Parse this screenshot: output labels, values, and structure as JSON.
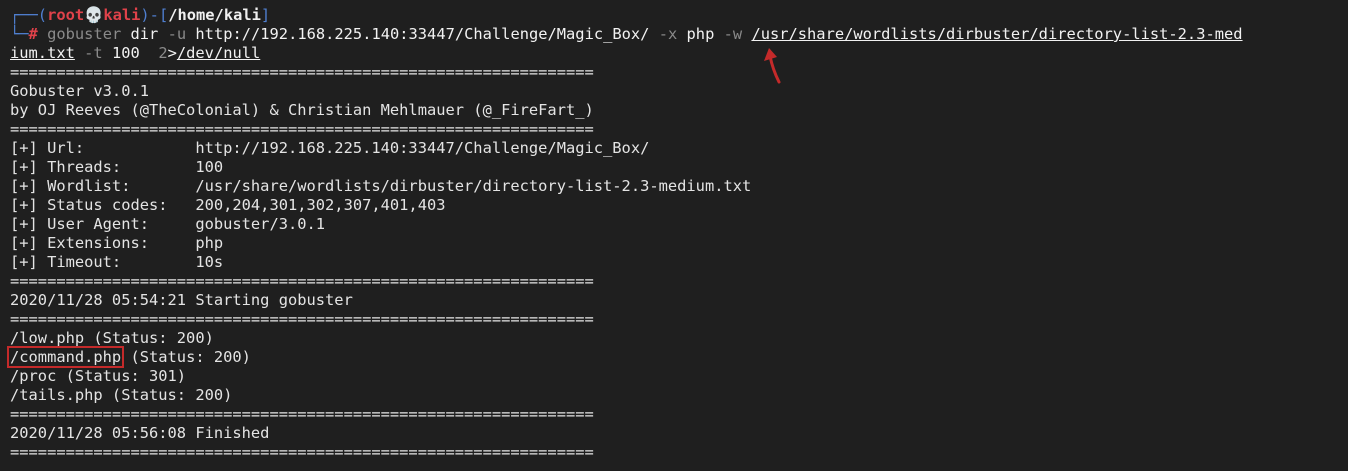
{
  "prompt": {
    "corner_top": "┌──(",
    "user": "root",
    "skull": "💀",
    "host": "kali",
    "separator": ")-[",
    "cwd": "/home/kali",
    "close": "]",
    "corner_bottom": "└─",
    "hash": "#"
  },
  "command": {
    "name": "gobuster",
    "sub": " dir ",
    "url_flag": "-u",
    "url": " http://192.168.225.140:33447/Challenge/Magic_Box/ ",
    "ext_flag": "-x",
    "ext": " php ",
    "wordlist_flag": "-w",
    "wordlist_part1": "/usr/share/wordlists/dirbuster/directory-list-2.3-med",
    "wordlist_part2": "ium.txt",
    "threads_flag": "-t",
    "threads": " 100  ",
    "redirect_fd": "2",
    "redirect_op": ">",
    "redirect_target": "/dev/null"
  },
  "output": {
    "separator": "===============================================================",
    "banner_line1": "Gobuster v3.0.1",
    "banner_line2": "by OJ Reeves (@TheColonial) & Christian Mehlmauer (@_FireFart_)",
    "config": [
      "[+] Url:            http://192.168.225.140:33447/Challenge/Magic_Box/",
      "[+] Threads:        100",
      "[+] Wordlist:       /usr/share/wordlists/dirbuster/directory-list-2.3-medium.txt",
      "[+] Status codes:   200,204,301,302,307,401,403",
      "[+] User Agent:     gobuster/3.0.1",
      "[+] Extensions:     php",
      "[+] Timeout:        10s"
    ],
    "start_line": "2020/11/28 05:54:21 Starting gobuster",
    "results": [
      "/low.php (Status: 200)",
      "/command.php",
      " (Status: 200)",
      "/proc (Status: 301)",
      "/tails.php (Status: 200)"
    ],
    "finish_line": "2020/11/28 05:56:08 Finished"
  },
  "colors": {
    "background": "#1f1f1f",
    "prompt_red": "#e0424a",
    "highlight_box": "#c42a2a",
    "prompt_blue": "#4f7fd0"
  }
}
